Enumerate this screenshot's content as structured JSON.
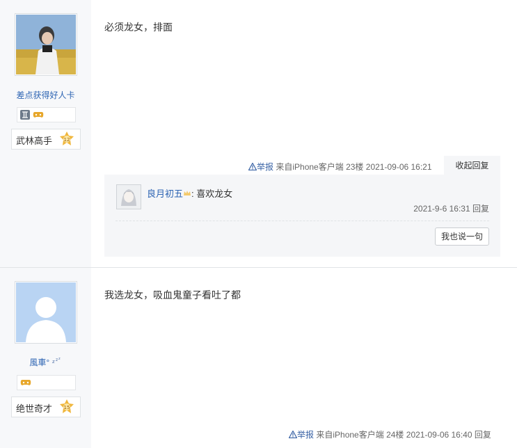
{
  "posts": [
    {
      "user": {
        "name": "差点获得好人卡",
        "level_title": "武林高手",
        "level_num": "12",
        "badges": [
          "gemini-icon",
          "gamepad-icon"
        ]
      },
      "content": "必须龙女，排面",
      "meta": {
        "report": "举报",
        "source": "来自iPhone客户端",
        "floor": "23楼",
        "time": "2021-09-06 16:21",
        "collapse": "收起回复"
      },
      "replies": [
        {
          "user": "良月初五",
          "text": ": 喜欢龙女",
          "time": "2021-9-6 16:31",
          "reply_label": "回复"
        }
      ],
      "say_button": "我也说一句"
    },
    {
      "user": {
        "name": "風車°",
        "level_title": "绝世奇才",
        "level_num": "15",
        "badges": [
          "gamepad-icon"
        ]
      },
      "content": "我选龙女，吸血鬼童子看吐了都",
      "meta": {
        "report": "举报",
        "source": "来自iPhone客户端",
        "floor": "24楼",
        "time": "2021-09-06 16:40",
        "reply": "回复"
      }
    }
  ],
  "colors": {
    "link": "#2d64b3",
    "sidebar_bg": "#f7f8fa",
    "reply_bg": "#f5f6f8"
  }
}
